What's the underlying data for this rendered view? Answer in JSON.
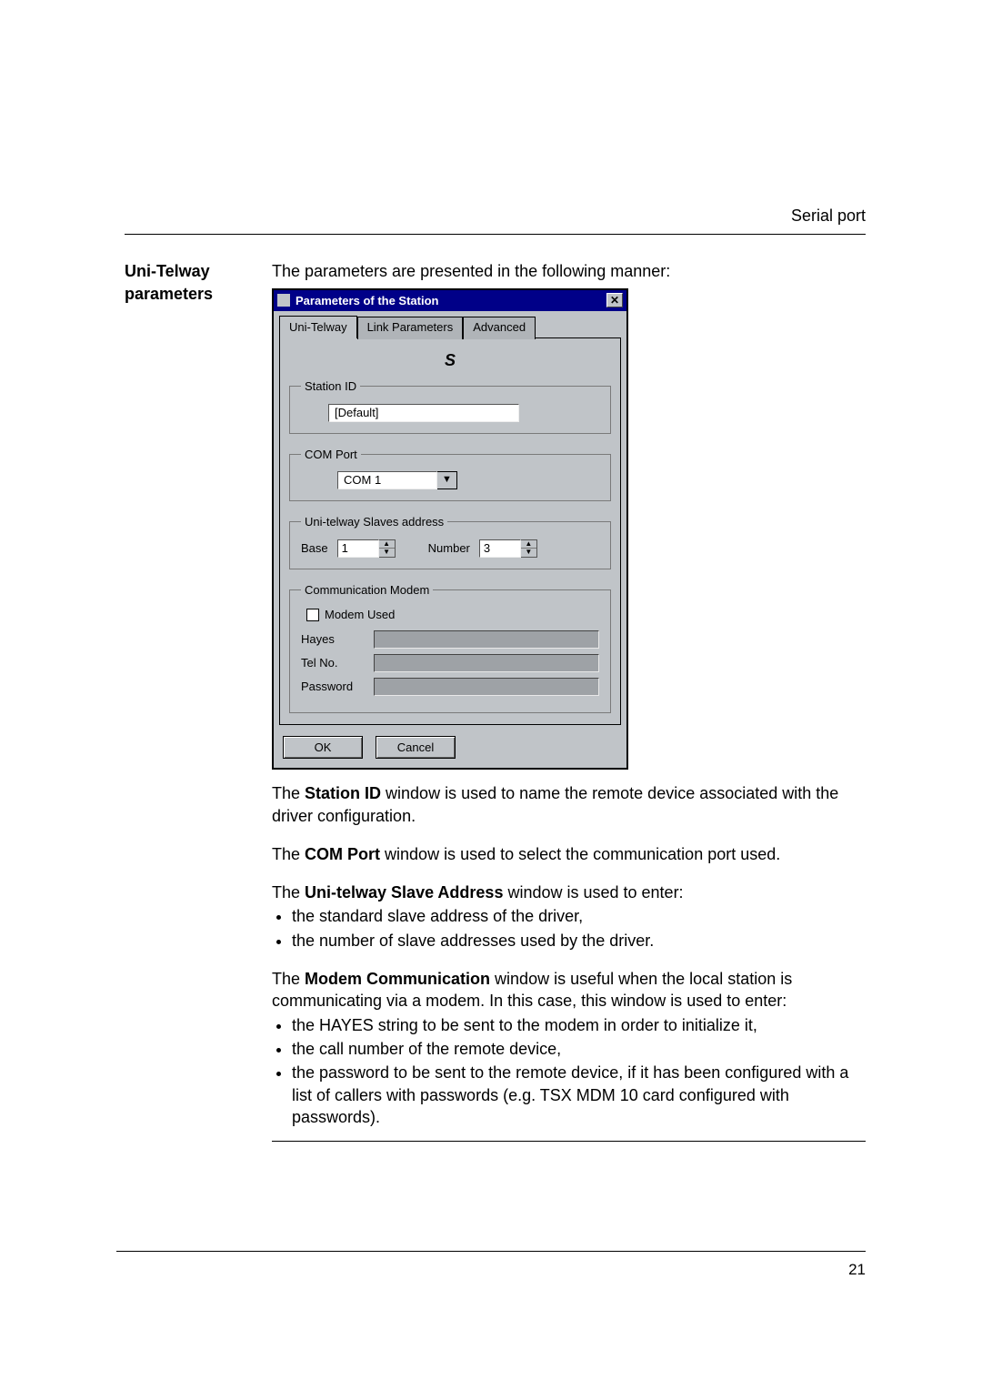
{
  "header": {
    "right_text": "Serial port"
  },
  "sidebar": {
    "title_line1": "Uni-Telway",
    "title_line2": "parameters"
  },
  "intro": "The parameters are presented in the following manner:",
  "dialog": {
    "title": "Parameters of the Station",
    "close_glyph": "✕",
    "tabs": {
      "t1": "Uni-Telway",
      "t2": "Link Parameters",
      "t3": "Advanced"
    },
    "brand_glyph": "S",
    "groups": {
      "station_id": {
        "legend": "Station ID",
        "value": "[Default]"
      },
      "com_port": {
        "legend": "COM Port",
        "value": "COM 1",
        "arrow": "▼"
      },
      "slaves": {
        "legend": "Uni-telway Slaves address",
        "base_label": "Base",
        "base_value": "1",
        "number_label": "Number",
        "number_value": "3",
        "up": "▲",
        "down": "▼"
      },
      "modem": {
        "legend": "Communication Modem",
        "checkbox_label": "Modem Used",
        "hayes_label": "Hayes",
        "tel_label": "Tel No.",
        "pwd_label": "Password"
      }
    },
    "buttons": {
      "ok": "OK",
      "cancel": "Cancel"
    }
  },
  "body": {
    "p1_a": "The  ",
    "p1_b": "Station ID",
    "p1_c": "  window is used to name the remote device associated with the driver configuration.",
    "p2_a": "The  ",
    "p2_b": "COM Port",
    "p2_c": "  window is used to select the communication port used.",
    "p3_a": "The ",
    "p3_b": "Uni-telway Slave Address",
    "p3_c": " window is used to enter:",
    "li1": "the standard slave address of the driver,",
    "li2": "the number of slave addresses used by the driver.",
    "p4_a": "The  ",
    "p4_b": "Modem Communication",
    "p4_c": "  window is useful when the local station is communicating via a modem. In this case, this window is used to enter:",
    "li3": "the HAYES string to be sent to the modem in order to initialize it,",
    "li4": "the call number of the remote device,",
    "li5": "the password to be sent to the remote device, if it has been configured with a list of callers with passwords (e.g. TSX MDM 10 card configured with passwords)."
  },
  "page_number": "21"
}
